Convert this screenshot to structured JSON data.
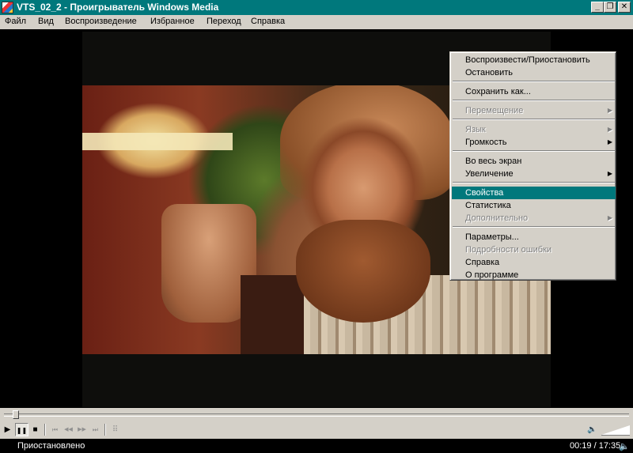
{
  "window": {
    "title": "VTS_02_2 - Проигрыватель Windows Media",
    "minimize": "_",
    "maximize": "❐",
    "close": "✕"
  },
  "menu": [
    "Файл",
    "Вид",
    "Воспроизведение",
    "Избранное",
    "Переход",
    "Справка"
  ],
  "context_menu": {
    "play_pause": "Воспроизвести/Приостановить",
    "stop": "Остановить",
    "save_as": "Сохранить как...",
    "seek": "Перемещение",
    "language": "Язык",
    "volume": "Громкость",
    "fullscreen": "Во весь экран",
    "zoom": "Увеличение",
    "properties": "Свойства",
    "statistics": "Статистика",
    "advanced": "Дополнительно",
    "options": "Параметры...",
    "error_details": "Подробности ошибки",
    "help": "Справка",
    "about": "О программе",
    "selected_item": "Свойства"
  },
  "controls": {
    "play": "▶",
    "pause": "❚❚",
    "stop": "■",
    "skip_back": "⏮",
    "rewind": "◀◀",
    "fast_forward": "▶▶",
    "skip_forward": "⏭",
    "playlist": "⠿",
    "mute": "🔈",
    "seek_position": 0.018
  },
  "status": {
    "text": "Приостановлено",
    "time": "00:19 / 17:35",
    "speaker": "🔈"
  },
  "colors": {
    "titlebar": "#00787c",
    "highlight": "#00787c",
    "face": "#d4d0c8"
  }
}
